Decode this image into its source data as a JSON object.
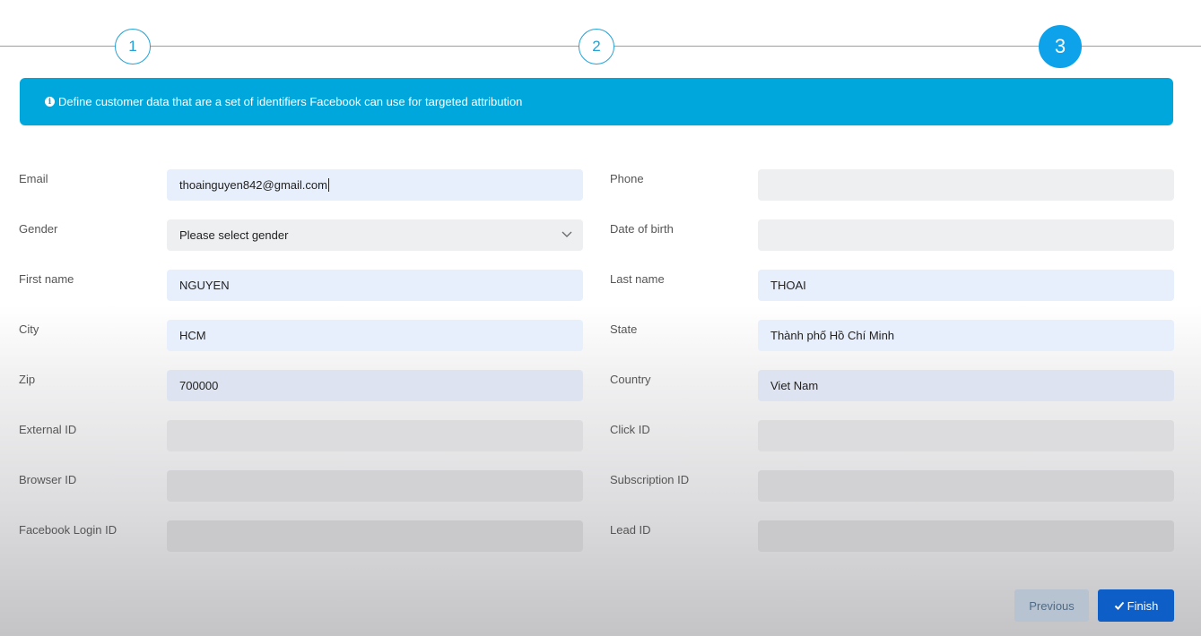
{
  "stepper": {
    "steps": [
      {
        "label": "1"
      },
      {
        "label": "2"
      },
      {
        "label": "3"
      }
    ],
    "active_step": 3
  },
  "alert": {
    "icon": "info-circle-icon",
    "text": "Define customer data that are a set of identifiers Facebook can use for targeted attribution"
  },
  "form": {
    "email": {
      "label": "Email",
      "value": "thoainguyen842@gmail.com"
    },
    "phone": {
      "label": "Phone",
      "value": ""
    },
    "gender": {
      "label": "Gender",
      "value": "Please select gender"
    },
    "date_of_birth": {
      "label": "Date of birth",
      "value": ""
    },
    "first_name": {
      "label": "First name",
      "value": "NGUYEN"
    },
    "last_name": {
      "label": "Last name",
      "value": "THOAI"
    },
    "city": {
      "label": "City",
      "value": "HCM"
    },
    "state": {
      "label": "State",
      "value": "Thành phố Hồ Chí Minh"
    },
    "zip": {
      "label": "Zip",
      "value": "700000"
    },
    "country": {
      "label": "Country",
      "value": "Viet Nam"
    },
    "external_id": {
      "label": "External ID",
      "value": ""
    },
    "click_id": {
      "label": "Click ID",
      "value": ""
    },
    "browser_id": {
      "label": "Browser ID",
      "value": ""
    },
    "subscription_id": {
      "label": "Subscription ID",
      "value": ""
    },
    "facebook_login_id": {
      "label": "Facebook Login ID",
      "value": ""
    },
    "lead_id": {
      "label": "Lead ID",
      "value": ""
    }
  },
  "buttons": {
    "previous": "Previous",
    "finish": "Finish"
  },
  "colors": {
    "accent": "#00a7dc",
    "step_active": "#0ea2ea",
    "finish_button": "#0d5ec7",
    "previous_button": "#b7c3d0"
  }
}
